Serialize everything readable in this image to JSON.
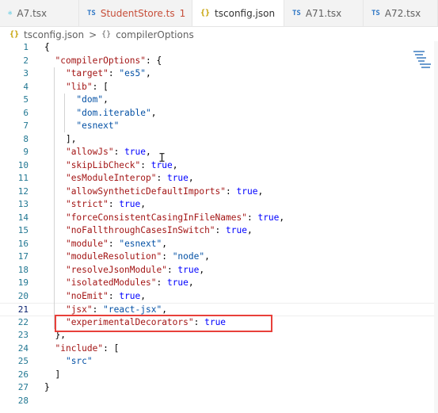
{
  "tabs": [
    {
      "icon": "react",
      "name": "A7.tsx",
      "modified": false,
      "problems": "",
      "active": false,
      "error": false
    },
    {
      "icon": "TS",
      "name": "StudentStore.ts",
      "modified": true,
      "problems": "1",
      "active": false,
      "error": true
    },
    {
      "icon": "{}",
      "name": "tsconfig.json",
      "modified": true,
      "problems": "",
      "active": true,
      "error": false
    },
    {
      "icon": "TS",
      "name": "A71.tsx",
      "modified": false,
      "problems": "",
      "active": false,
      "error": false
    },
    {
      "icon": "TS",
      "name": "A72.tsx",
      "modified": false,
      "problems": "",
      "active": false,
      "error": false
    }
  ],
  "breadcrumb": {
    "file": "tsconfig.json",
    "separator": ">",
    "symbol_icon": "{}",
    "symbol": "compilerOptions"
  },
  "lines": [
    {
      "n": "1",
      "tokens": [
        {
          "t": "{",
          "c": "p"
        }
      ]
    },
    {
      "n": "2",
      "tokens": [
        {
          "t": "  "
        },
        {
          "t": "\"compilerOptions\"",
          "c": "k"
        },
        {
          "t": ": {",
          "c": "p"
        }
      ]
    },
    {
      "n": "3",
      "tokens": [
        {
          "t": "    "
        },
        {
          "t": "\"target\"",
          "c": "k"
        },
        {
          "t": ": ",
          "c": "p"
        },
        {
          "t": "\"es5\"",
          "c": "s"
        },
        {
          "t": ",",
          "c": "p"
        }
      ]
    },
    {
      "n": "4",
      "tokens": [
        {
          "t": "    "
        },
        {
          "t": "\"lib\"",
          "c": "k"
        },
        {
          "t": ": [",
          "c": "p"
        }
      ]
    },
    {
      "n": "5",
      "tokens": [
        {
          "t": "      "
        },
        {
          "t": "\"dom\"",
          "c": "s"
        },
        {
          "t": ",",
          "c": "p"
        }
      ]
    },
    {
      "n": "6",
      "tokens": [
        {
          "t": "      "
        },
        {
          "t": "\"dom.iterable\"",
          "c": "s"
        },
        {
          "t": ",",
          "c": "p"
        }
      ]
    },
    {
      "n": "7",
      "tokens": [
        {
          "t": "      "
        },
        {
          "t": "\"esnext\"",
          "c": "s"
        }
      ]
    },
    {
      "n": "8",
      "tokens": [
        {
          "t": "    "
        },
        {
          "t": "],",
          "c": "p"
        }
      ]
    },
    {
      "n": "9",
      "tokens": [
        {
          "t": "    "
        },
        {
          "t": "\"allowJs\"",
          "c": "k"
        },
        {
          "t": ": ",
          "c": "p"
        },
        {
          "t": "true",
          "c": "kw"
        },
        {
          "t": ",",
          "c": "p"
        }
      ]
    },
    {
      "n": "10",
      "tokens": [
        {
          "t": "    "
        },
        {
          "t": "\"skipLibCheck\"",
          "c": "k"
        },
        {
          "t": ": ",
          "c": "p"
        },
        {
          "t": "true",
          "c": "kw"
        },
        {
          "t": ",",
          "c": "p"
        }
      ]
    },
    {
      "n": "11",
      "tokens": [
        {
          "t": "    "
        },
        {
          "t": "\"esModuleInterop\"",
          "c": "k"
        },
        {
          "t": ": ",
          "c": "p"
        },
        {
          "t": "true",
          "c": "kw"
        },
        {
          "t": ",",
          "c": "p"
        }
      ]
    },
    {
      "n": "12",
      "tokens": [
        {
          "t": "    "
        },
        {
          "t": "\"allowSyntheticDefaultImports\"",
          "c": "k"
        },
        {
          "t": ": ",
          "c": "p"
        },
        {
          "t": "true",
          "c": "kw"
        },
        {
          "t": ",",
          "c": "p"
        }
      ]
    },
    {
      "n": "13",
      "tokens": [
        {
          "t": "    "
        },
        {
          "t": "\"strict\"",
          "c": "k"
        },
        {
          "t": ": ",
          "c": "p"
        },
        {
          "t": "true",
          "c": "kw"
        },
        {
          "t": ",",
          "c": "p"
        }
      ]
    },
    {
      "n": "14",
      "tokens": [
        {
          "t": "    "
        },
        {
          "t": "\"forceConsistentCasingInFileNames\"",
          "c": "k"
        },
        {
          "t": ": ",
          "c": "p"
        },
        {
          "t": "true",
          "c": "kw"
        },
        {
          "t": ",",
          "c": "p"
        }
      ]
    },
    {
      "n": "15",
      "tokens": [
        {
          "t": "    "
        },
        {
          "t": "\"noFallthroughCasesInSwitch\"",
          "c": "k"
        },
        {
          "t": ": ",
          "c": "p"
        },
        {
          "t": "true",
          "c": "kw"
        },
        {
          "t": ",",
          "c": "p"
        }
      ]
    },
    {
      "n": "16",
      "tokens": [
        {
          "t": "    "
        },
        {
          "t": "\"module\"",
          "c": "k"
        },
        {
          "t": ": ",
          "c": "p"
        },
        {
          "t": "\"esnext\"",
          "c": "s"
        },
        {
          "t": ",",
          "c": "p"
        }
      ]
    },
    {
      "n": "17",
      "tokens": [
        {
          "t": "    "
        },
        {
          "t": "\"moduleResolution\"",
          "c": "k"
        },
        {
          "t": ": ",
          "c": "p"
        },
        {
          "t": "\"node\"",
          "c": "s"
        },
        {
          "t": ",",
          "c": "p"
        }
      ]
    },
    {
      "n": "18",
      "tokens": [
        {
          "t": "    "
        },
        {
          "t": "\"resolveJsonModule\"",
          "c": "k"
        },
        {
          "t": ": ",
          "c": "p"
        },
        {
          "t": "true",
          "c": "kw"
        },
        {
          "t": ",",
          "c": "p"
        }
      ]
    },
    {
      "n": "19",
      "tokens": [
        {
          "t": "    "
        },
        {
          "t": "\"isolatedModules\"",
          "c": "k"
        },
        {
          "t": ": ",
          "c": "p"
        },
        {
          "t": "true",
          "c": "kw"
        },
        {
          "t": ",",
          "c": "p"
        }
      ]
    },
    {
      "n": "20",
      "tokens": [
        {
          "t": "    "
        },
        {
          "t": "\"noEmit\"",
          "c": "k"
        },
        {
          "t": ": ",
          "c": "p"
        },
        {
          "t": "true",
          "c": "kw"
        },
        {
          "t": ",",
          "c": "p"
        }
      ]
    },
    {
      "n": "21",
      "tokens": [
        {
          "t": "    "
        },
        {
          "t": "\"jsx\"",
          "c": "k"
        },
        {
          "t": ": ",
          "c": "p"
        },
        {
          "t": "\"react-jsx\"",
          "c": "s"
        },
        {
          "t": ",",
          "c": "p"
        }
      ]
    },
    {
      "n": "22",
      "tokens": [
        {
          "t": "    "
        },
        {
          "t": "\"experimentalDecorators\"",
          "c": "k"
        },
        {
          "t": ": ",
          "c": "p"
        },
        {
          "t": "true",
          "c": "kw"
        }
      ]
    },
    {
      "n": "23",
      "tokens": [
        {
          "t": "  "
        },
        {
          "t": "},",
          "c": "p"
        }
      ]
    },
    {
      "n": "24",
      "tokens": [
        {
          "t": "  "
        },
        {
          "t": "\"include\"",
          "c": "k"
        },
        {
          "t": ": [",
          "c": "p"
        }
      ]
    },
    {
      "n": "25",
      "tokens": [
        {
          "t": "    "
        },
        {
          "t": "\"src\"",
          "c": "s"
        }
      ]
    },
    {
      "n": "26",
      "tokens": [
        {
          "t": "  "
        },
        {
          "t": "]",
          "c": "p"
        }
      ]
    },
    {
      "n": "27",
      "tokens": [
        {
          "t": "}",
          "c": "p"
        }
      ]
    },
    {
      "n": "28",
      "tokens": []
    }
  ],
  "current_line": "21",
  "highlighted_line": "22",
  "colors": {
    "key": "#a31515",
    "string": "#0451a5",
    "keyword": "#0000ff",
    "line_number": "#237893",
    "highlight_box": "#e8403a"
  }
}
